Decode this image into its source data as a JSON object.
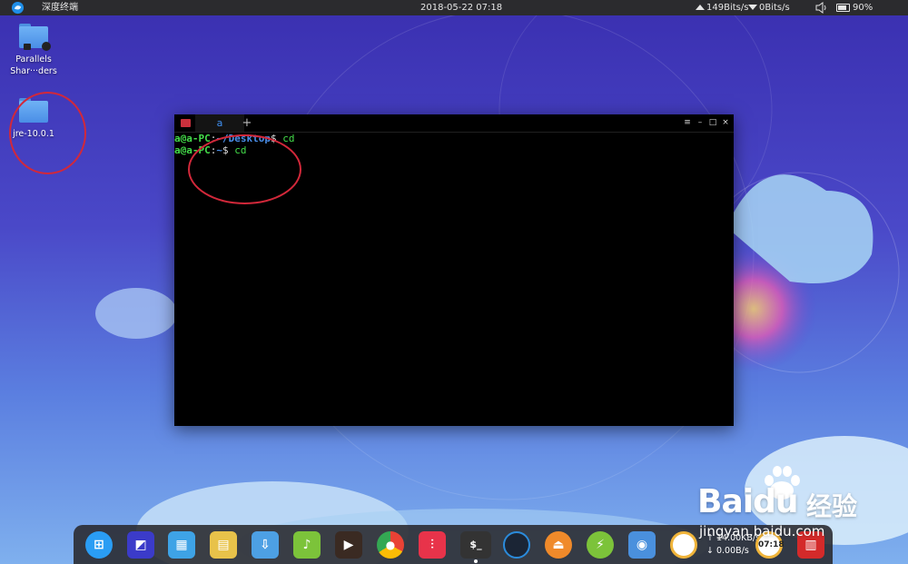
{
  "topbar": {
    "app_title": "深度终端",
    "clock": "2018-05-22 07:18",
    "net_up": "149Bits/s",
    "net_down": "0Bits/s",
    "battery": "90%"
  },
  "desktop": {
    "icons": [
      {
        "label_line1": "Parallels",
        "label_line2": "Shar···ders"
      },
      {
        "label_line1": "jre-10.0.1"
      }
    ]
  },
  "terminal": {
    "tab_label": "a",
    "new_tab_label": "+",
    "lines": [
      {
        "user_host": "a@a-PC",
        "sep": ":",
        "path": "~/Desktop",
        "prompt": "$",
        "command": " cd"
      },
      {
        "user_host": "a@a-PC",
        "sep": ":",
        "path": "~",
        "prompt": "$",
        "command": " cd"
      }
    ]
  },
  "dock": {
    "net_up": "↑ 14.00KB/s",
    "net_down": "↓ 0.00B/s",
    "clock_icon_text": "07:18",
    "items": [
      {
        "name": "launcher-icon",
        "color": "#2a9df4"
      },
      {
        "name": "screenshot-icon",
        "color": "#3b3bc9"
      },
      {
        "name": "multitask-view-icon",
        "color": "#3ea3e6"
      },
      {
        "name": "file-manager-icon",
        "color": "#e8c24a"
      },
      {
        "name": "app-store-icon",
        "color": "#4da0e4"
      },
      {
        "name": "music-icon",
        "color": "#7cc33a"
      },
      {
        "name": "movie-icon",
        "color": "#3a2a22"
      },
      {
        "name": "chrome-icon",
        "color": "#e94235"
      },
      {
        "name": "control-center-icon",
        "color": "#e8334a"
      },
      {
        "name": "terminal-icon",
        "color": "#333"
      },
      {
        "name": "system-monitor-icon",
        "color": "#2b8bdb"
      },
      {
        "name": "install-icon",
        "color": "#f08a2a"
      },
      {
        "name": "cleaner-icon",
        "color": "#7cc33a"
      },
      {
        "name": "folder-network-icon",
        "color": "#4a90dd"
      },
      {
        "name": "shutdown-icon",
        "color": "#f0b43a"
      },
      {
        "name": "trash-icon",
        "color": "#d42a2a"
      }
    ]
  },
  "watermark": {
    "brand": "Baidu",
    "cn": "经验",
    "url": "jingyan.baidu.com"
  }
}
